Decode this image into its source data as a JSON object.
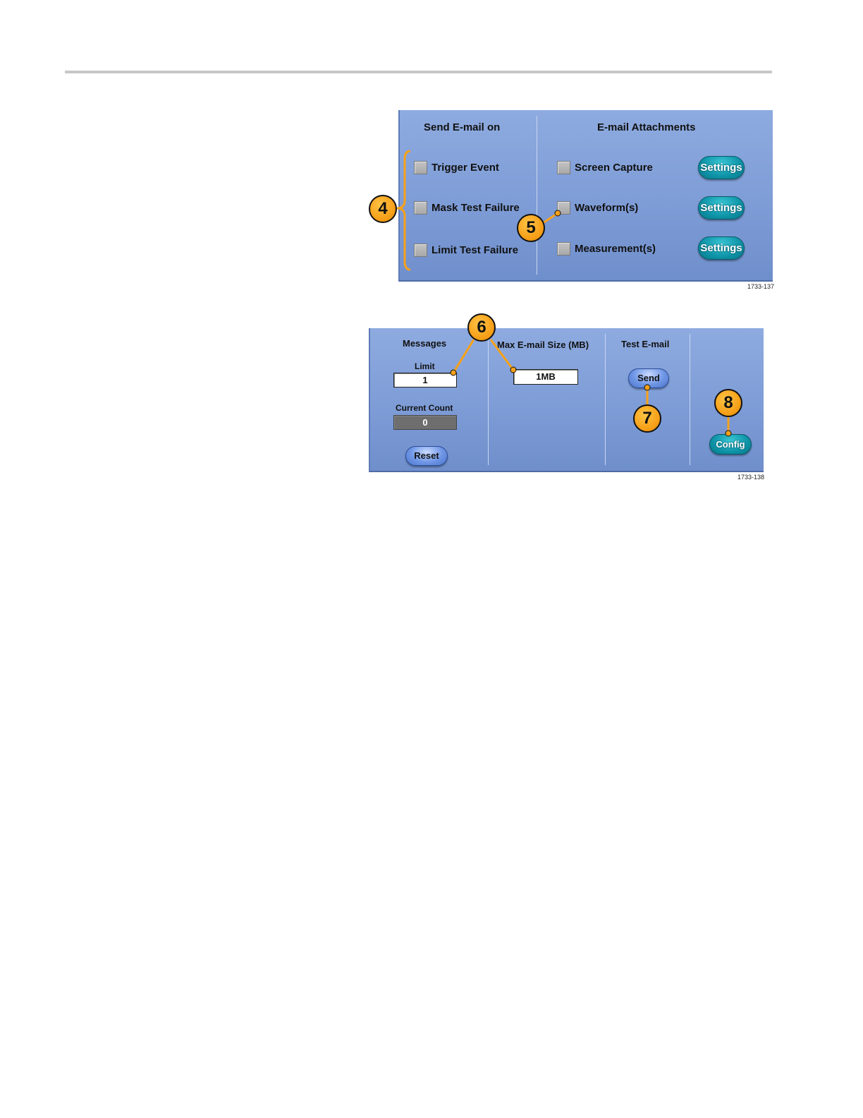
{
  "panel_send": {
    "send_heading": "Send E-mail on",
    "attach_heading": "E-mail Attachments",
    "triggers": [
      {
        "label": "Trigger Event"
      },
      {
        "label": "Mask Test Failure"
      },
      {
        "label": "Limit Test Failure"
      }
    ],
    "attachments": [
      {
        "label": "Screen Capture",
        "button": "Settings"
      },
      {
        "label": "Waveform(s)",
        "button": "Settings"
      },
      {
        "label": "Measurement(s)",
        "button": "Settings"
      }
    ],
    "figure_id": "1733-137"
  },
  "panel_config": {
    "messages_heading": "Messages",
    "limit_label": "Limit",
    "limit_value": "1",
    "current_count_label": "Current Count",
    "current_count_value": "0",
    "reset_label": "Reset",
    "max_size_heading": "Max E-mail Size (MB)",
    "max_size_value": "1MB",
    "test_heading": "Test E-mail",
    "send_label": "Send",
    "config_label": "Config",
    "figure_id": "1733-138"
  },
  "callouts": {
    "c4": "4",
    "c5": "5",
    "c6": "6",
    "c7": "7",
    "c8": "8"
  },
  "colors": {
    "panel": "#7e9cd6",
    "callout": "#f7a11a",
    "teal_button": "#0e93a7"
  }
}
